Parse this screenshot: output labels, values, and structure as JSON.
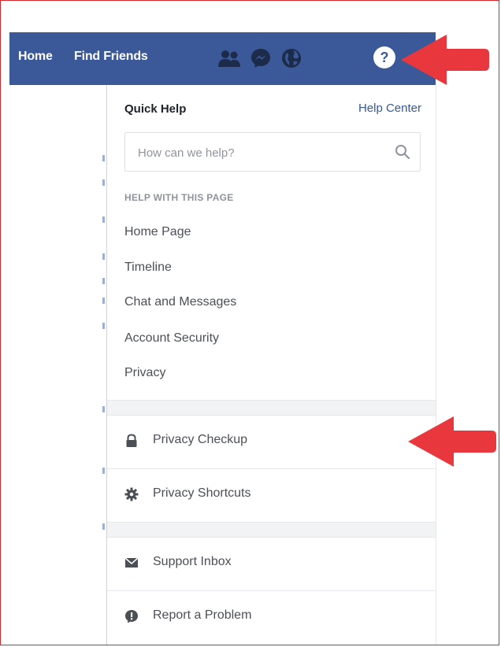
{
  "nav": {
    "home_label": "Home",
    "find_friends_label": "Find Friends",
    "icons": [
      "friends-icon",
      "messenger-icon",
      "globe-icon",
      "help-icon"
    ],
    "bar_color": "#3b5998"
  },
  "quick_help": {
    "title": "Quick Help",
    "help_center_label": "Help Center",
    "search_placeholder": "How can we help?",
    "section_label": "HELP WITH THIS PAGE",
    "links": [
      "Home Page",
      "Timeline",
      "Chat and Messages",
      "Account Security",
      "Privacy"
    ]
  },
  "privacy_items": [
    {
      "label": "Privacy Checkup",
      "icon": "lock-icon"
    },
    {
      "label": "Privacy Shortcuts",
      "icon": "gear-icon"
    }
  ],
  "support_items": [
    {
      "label": "Support Inbox",
      "icon": "inbox-icon"
    },
    {
      "label": "Report a Problem",
      "icon": "report-icon"
    }
  ],
  "colors": {
    "accent_link": "#365899",
    "annotation_arrow": "#e8383d"
  }
}
